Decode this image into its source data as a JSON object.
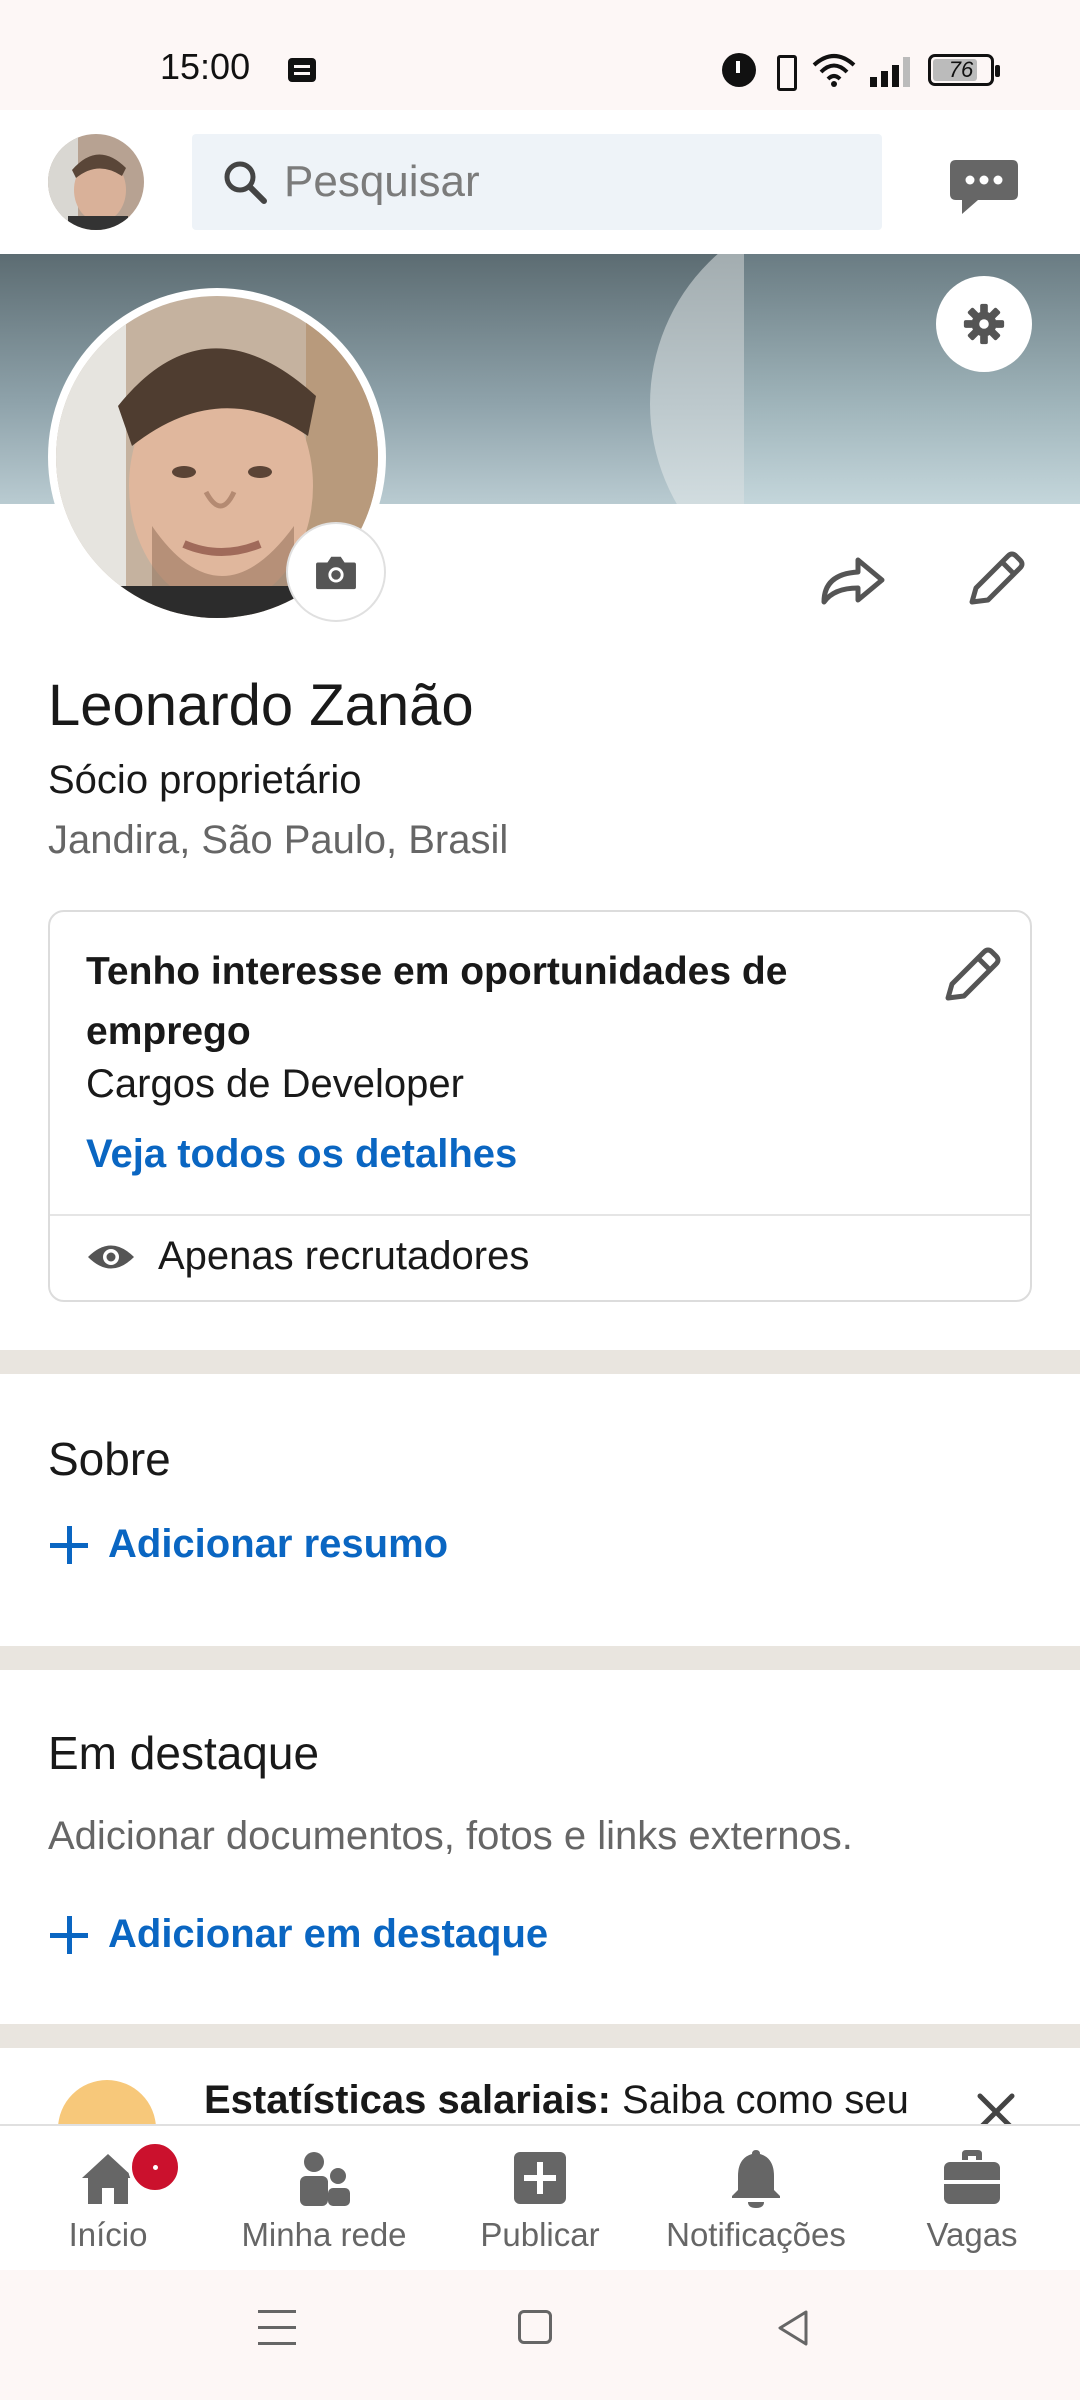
{
  "status_bar": {
    "time": "15:00",
    "battery": "76",
    "icons": [
      "message-icon",
      "alarm-icon",
      "vibrate-icon",
      "wifi-icon",
      "signal-icon",
      "battery-icon"
    ]
  },
  "top_bar": {
    "search_placeholder": "Pesquisar",
    "icons": [
      "avatar",
      "search-icon",
      "chat-icon"
    ]
  },
  "profile": {
    "name": "Leonardo Zanão",
    "headline": "Sócio proprietário",
    "location": "Jandira, São Paulo, Brasil"
  },
  "open_to_work": {
    "title": "Tenho interesse em oportunidades de emprego",
    "roles": "Cargos de Developer",
    "details_link": "Veja todos os detalhes",
    "visibility": "Apenas recrutadores"
  },
  "about": {
    "title": "Sobre",
    "add_label": "Adicionar resumo"
  },
  "featured": {
    "title": "Em destaque",
    "subtitle": "Adicionar documentos, fotos e links externos.",
    "add_label": "Adicionar em destaque"
  },
  "promo": {
    "bold": "Estatísticas salariais:",
    "text": " Saiba como seu"
  },
  "bottom_nav": {
    "items": [
      {
        "label": "Início",
        "icon": "home-icon"
      },
      {
        "label": "Minha rede",
        "icon": "network-icon"
      },
      {
        "label": "Publicar",
        "icon": "post-icon"
      },
      {
        "label": "Notificações",
        "icon": "bell-icon"
      },
      {
        "label": "Vagas",
        "icon": "briefcase-icon"
      }
    ]
  },
  "colors": {
    "accent": "#0a66c2",
    "badge": "#cb112d",
    "separator": "#e9e5df",
    "search_bg": "#eef3f8"
  }
}
